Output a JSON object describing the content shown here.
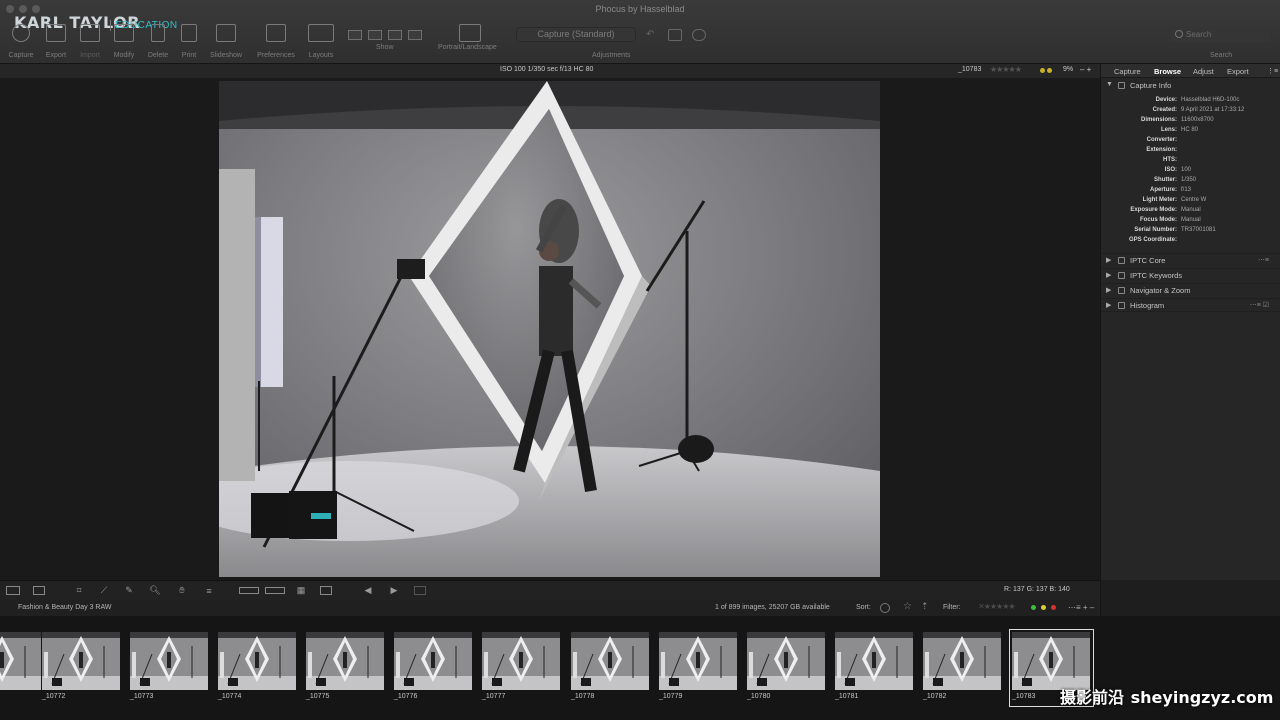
{
  "window": {
    "title": "Phocus by Hasselblad"
  },
  "brand": {
    "name": "KARL TAYLOR",
    "sub": "EDUCATION"
  },
  "toolbar": {
    "items": [
      {
        "label": "Capture",
        "icon": "capture-icon"
      },
      {
        "label": "Export",
        "icon": "export-icon"
      },
      {
        "label": "Import",
        "icon": "import-icon"
      },
      {
        "label": "Modify",
        "icon": "modify-icon"
      },
      {
        "label": "Delete",
        "icon": "trash-icon"
      },
      {
        "label": "Print",
        "icon": "printer-icon"
      },
      {
        "label": "Slideshow",
        "icon": "slideshow-icon"
      },
      {
        "label": "Preferences",
        "icon": "preferences-icon"
      },
      {
        "label": "Layouts",
        "icon": "layouts-icon"
      }
    ],
    "show_label": "Show",
    "portrait_label": "Portrait/Landscape",
    "capture_select": "Capture (Standard)",
    "adjustments_label": "Adjustments",
    "search_placeholder": "Search",
    "search_label": "Search"
  },
  "infobar": {
    "exif": "ISO 100   1/350 sec   f/13   HC 80",
    "image_name": "_10783",
    "stars": "★★★★★",
    "color_tags": [
      "#c9b22b",
      "#c9b22b"
    ],
    "zoom": "9%",
    "zoom_controls": "–  +"
  },
  "panel": {
    "tabs": [
      "Capture",
      "Browse",
      "Adjust",
      "Export"
    ],
    "active_tab": "Browse",
    "capture_info": {
      "title": "Capture Info",
      "rows": [
        {
          "k": "Device:",
          "v": "Hasselblad H6D-100c"
        },
        {
          "k": "Created:",
          "v": "9 April 2021 at 17:33:12"
        },
        {
          "k": "Dimensions:",
          "v": "11600x8700"
        },
        {
          "k": "Lens:",
          "v": "HC 80"
        },
        {
          "k": "Converter:",
          "v": ""
        },
        {
          "k": "Extension:",
          "v": ""
        },
        {
          "k": "HTS:",
          "v": ""
        },
        {
          "k": "ISO:",
          "v": "100"
        },
        {
          "k": "Shutter:",
          "v": "1/350"
        },
        {
          "k": "Aperture:",
          "v": "f/13"
        },
        {
          "k": "Light Meter:",
          "v": "Centre W"
        },
        {
          "k": "Exposure Mode:",
          "v": "Manual"
        },
        {
          "k": "Focus Mode:",
          "v": "Manual"
        },
        {
          "k": "Serial Number:",
          "v": "TR37001081"
        },
        {
          "k": "GPS Coordinate:",
          "v": ""
        }
      ]
    },
    "sections": [
      "IPTC Core",
      "IPTC Keywords",
      "Navigator & Zoom",
      "Histogram"
    ]
  },
  "bottombar": {
    "rgb": "R: 137   G: 137   B: 140"
  },
  "browser": {
    "folder": "Fashion & Beauty Day 3 RAW",
    "count": "1 of 899 images, 25207 GB available",
    "sort_label": "Sort:",
    "filter_label": "Filter:"
  },
  "filmstrip": {
    "items": [
      "_10772",
      "_10773",
      "_10774",
      "_10775",
      "_10776",
      "_10777",
      "_10778",
      "_10779",
      "_10780",
      "_10781",
      "_10782",
      "_10783"
    ],
    "selected": "_10783"
  },
  "watermark": {
    "cn": "摄影前沿",
    "latin": "sheyingzyz.com"
  }
}
